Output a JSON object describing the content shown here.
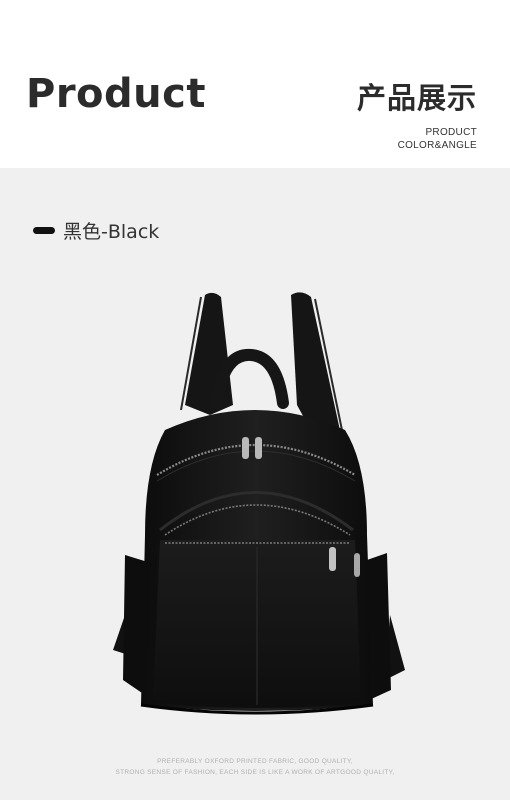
{
  "header": {
    "title_en": "Product",
    "title_cn": "产品展示",
    "subtitle_line1": "PRODUCT",
    "subtitle_line2": "COLOR&ANGLE"
  },
  "color_option": {
    "label": "黑色-Black",
    "swatch_color": "#111111"
  },
  "product_image": {
    "subject": "black leather backpack"
  },
  "footer": {
    "line1": "PREFERABLY OXFORD PRINTED FABRIC, GOOD QUALITY,",
    "line2": "STRONG SENSE OF FASHION, EACH SIDE IS LIKE A WORK OF ARTGOOD QUALITY,"
  }
}
